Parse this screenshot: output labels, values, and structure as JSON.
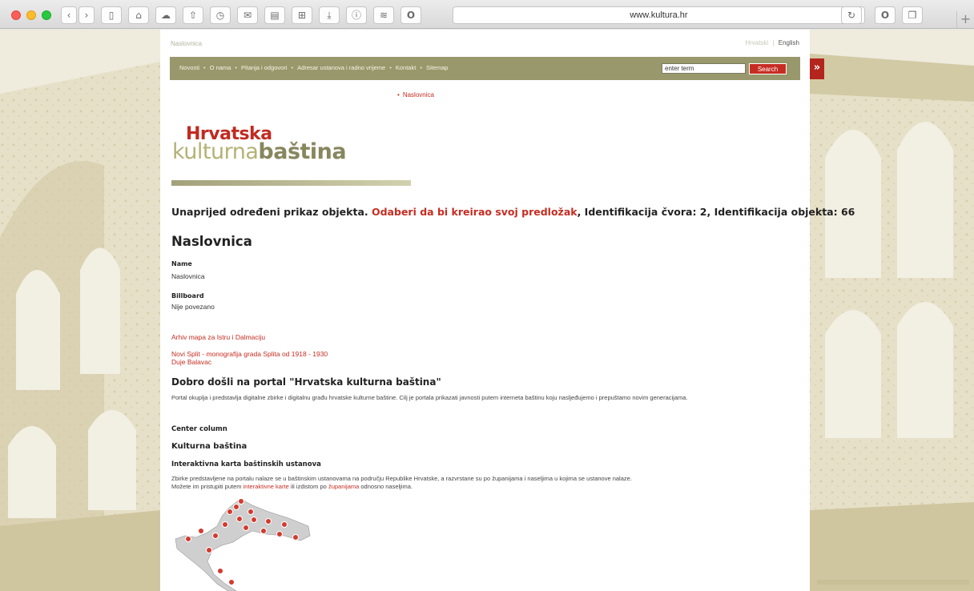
{
  "browser": {
    "url": "www.kultura.hr"
  },
  "site": {
    "breadcrumb": "Naslovnica",
    "lang_hr": "Hrvatski",
    "lang_separator": "|",
    "lang_en": "English",
    "nav": [
      "Novosti",
      "O nama",
      "Pitanja i odgovori",
      "Adresar ustanova i radno vrijeme",
      "Kontakt",
      "Sitemap"
    ],
    "nav_separator": "•",
    "search_placeholder": "enter term",
    "search_button": "Search",
    "sidetab": "»",
    "subnav_bullet": "•",
    "subnav_link": "Naslovnica",
    "logo_line1": "Hrvatska",
    "logo_line2a": "kulturna",
    "logo_line2b": "baština"
  },
  "content": {
    "object_head_a": "Unaprijed određeni prikaz objekta.",
    "object_head_link": "Odaberi da bi kreirao svoj predložak",
    "object_head_b": ", Identifikacija čvora: 2, Identifikacija objekta: 66",
    "title": "Naslovnica",
    "name_label": "Name",
    "name_value": "Naslovnica",
    "billboard_label": "Billboard",
    "billboard_value": "Nije povezano",
    "link1": "Arhiv mapa za Istru i Dalmaciju",
    "link2": "Novi Split - monografija grada Splita od 1918 - 1930",
    "link3": "Duje Balavac",
    "welcome_title": "Dobro došli na portal \"Hrvatska kulturna baština\"",
    "welcome_text": "Portal okuplja i predstavlja digitalne zbirke i digitalnu građu hrvatske kulturne baštine. Cilj je portala prikazati javnosti putem interneta baštinu koju nasljeđujemo i prepuštamo novim generacijama.",
    "center_column": "Center column",
    "heritage_title": "Kulturna baština",
    "map_title": "Interaktivna karta baštinskih ustanova",
    "map_text_1": "Zbirke predstavljene na portalu nalaze se u baštinskim ustanovama na području Republike Hrvatske, a razvrstane su po županijama i naseljima u kojima se ustanove nalaze.",
    "map_text_2a": "Možete im pristupiti putem ",
    "map_link_1": "interaktivne karte",
    "map_text_2b": " ili izdistom po ",
    "map_link_2": "županijama",
    "map_text_2c": " odnosno naseljima."
  },
  "colors": {
    "accent_red": "#c62d22",
    "olive": "#99986c",
    "page_bg": "#efebdd"
  }
}
